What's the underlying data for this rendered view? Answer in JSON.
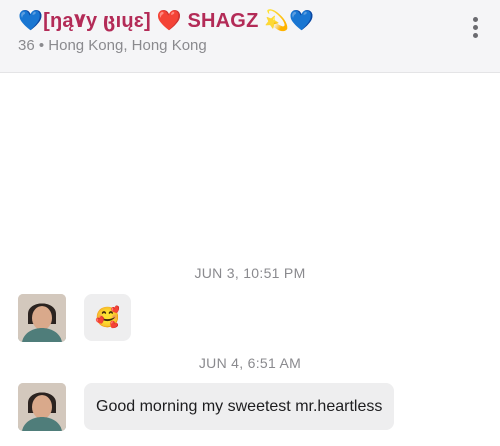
{
  "header": {
    "title_prefix_emoji": "💙",
    "title_name": "[ŋą٧у ცıųɛ]",
    "title_heart_emoji": "❤️",
    "title_nickname": "SHAGZ",
    "title_star_emoji": "💫",
    "title_suffix_emoji": "💙",
    "subtitle": "36 • Hong Kong, Hong Kong",
    "menu_icon": "more-vertical-icon"
  },
  "messages": [
    {
      "divider": "JUN 3, 10:51 PM",
      "text": "🥰"
    },
    {
      "divider": "JUN 4, 6:51 AM",
      "text": "Good morning my sweetest mr.heartless"
    }
  ],
  "colors": {
    "header_bg": "#f5f5f7",
    "title": "#b32b57",
    "subtitle": "#8a8a8e",
    "bubble_bg": "#eeeeef"
  }
}
